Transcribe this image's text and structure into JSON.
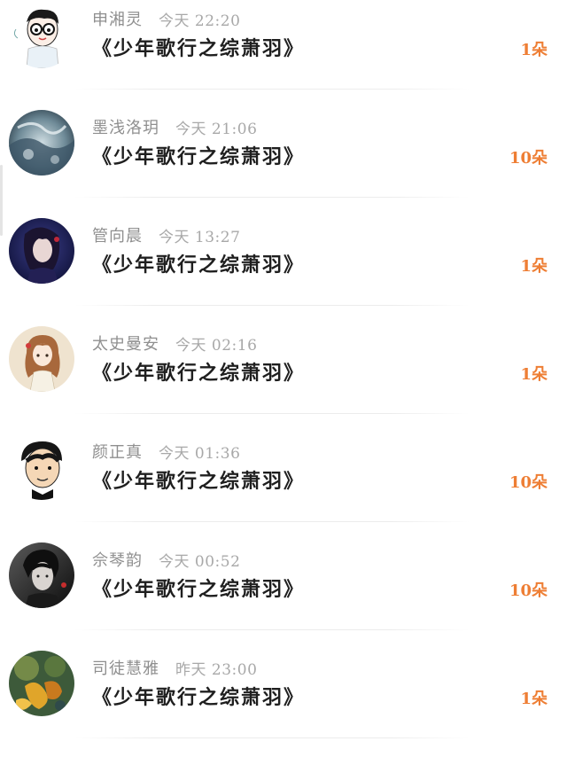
{
  "rows": [
    {
      "name": "申湘灵",
      "time": "今天 22:20",
      "title": "《少年歌行之综萧羽》",
      "count": "1朵",
      "avatar": "cartoon-boy-glasses-avatar"
    },
    {
      "name": "墨浅洛玥",
      "time": "今天 21:06",
      "title": "《少年歌行之综萧羽》",
      "count": "10朵",
      "avatar": "ink-painting-avatar"
    },
    {
      "name": "管向晨",
      "time": "今天 13:27",
      "title": "《少年歌行之综萧羽》",
      "count": "1朵",
      "avatar": "anime-girl-dark-avatar"
    },
    {
      "name": "太史曼安",
      "time": "今天 02:16",
      "title": "《少年歌行之综萧羽》",
      "count": "1朵",
      "avatar": "anime-girl-curly-avatar"
    },
    {
      "name": "颜正真",
      "time": "今天 01:36",
      "title": "《少年歌行之综萧羽》",
      "count": "10朵",
      "avatar": "cartoon-man-avatar"
    },
    {
      "name": "佘琴韵",
      "time": "今天 00:52",
      "title": "《少年歌行之综萧羽》",
      "count": "10朵",
      "avatar": "dark-portrait-avatar"
    },
    {
      "name": "司徒慧雅",
      "time": "昨天 23:00",
      "title": "《少年歌行之综萧羽》",
      "count": "1朵",
      "avatar": "autumn-leaves-avatar"
    }
  ],
  "colors": {
    "count": "#ee7e34",
    "name": "#8f8f8f",
    "time": "#a8a8a8",
    "title": "#1f1f1f"
  }
}
